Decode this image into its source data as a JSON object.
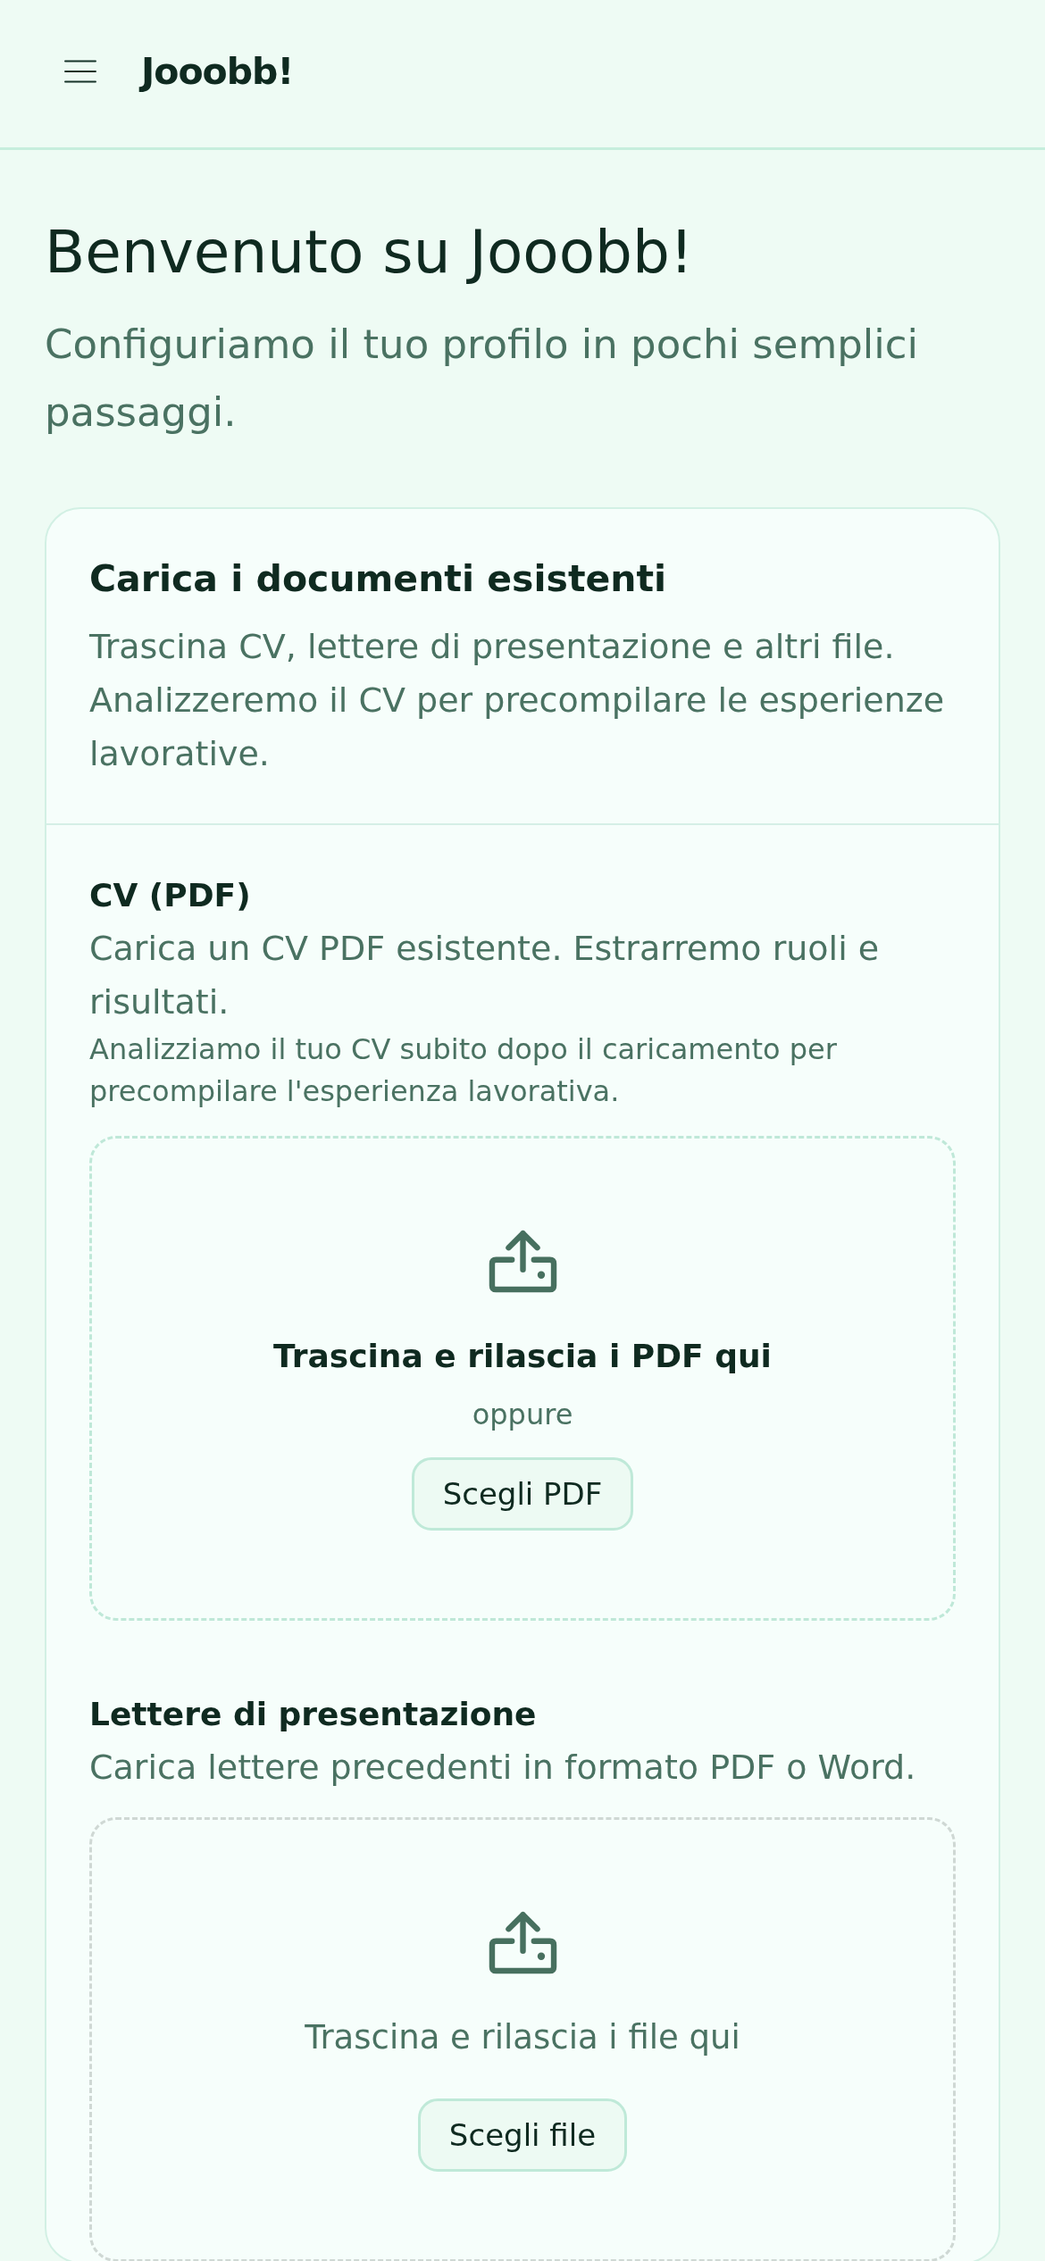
{
  "header": {
    "logo": "Jooobb!"
  },
  "intro": {
    "title": "Benvenuto su Jooobb!",
    "subtitle": "Configuriamo il tuo profilo in pochi semplici passaggi."
  },
  "card": {
    "title": "Carica i documenti esistenti",
    "description": "Trascina CV, lettere di presentazione e altri file. Analizzeremo il CV per precompilare le esperienze lavorative.",
    "sections": [
      {
        "title": "CV (PDF)",
        "description": "Carica un CV PDF esistente. Estrarremo ruoli e risultati.",
        "note": "Analizziamo il tuo CV subito dopo il caricamento per precompilare l'esperienza lavorativa.",
        "dropzone": {
          "active": true,
          "prompt": "Trascina e rilascia i PDF qui",
          "separator": "oppure",
          "button": "Scegli PDF"
        }
      },
      {
        "title": "Lettere di presentazione",
        "description": "Carica lettere precedenti in formato PDF o Word.",
        "dropzone": {
          "active": false,
          "prompt": "Trascina e rilascia i file qui",
          "button": "Scegli file"
        }
      }
    ]
  }
}
